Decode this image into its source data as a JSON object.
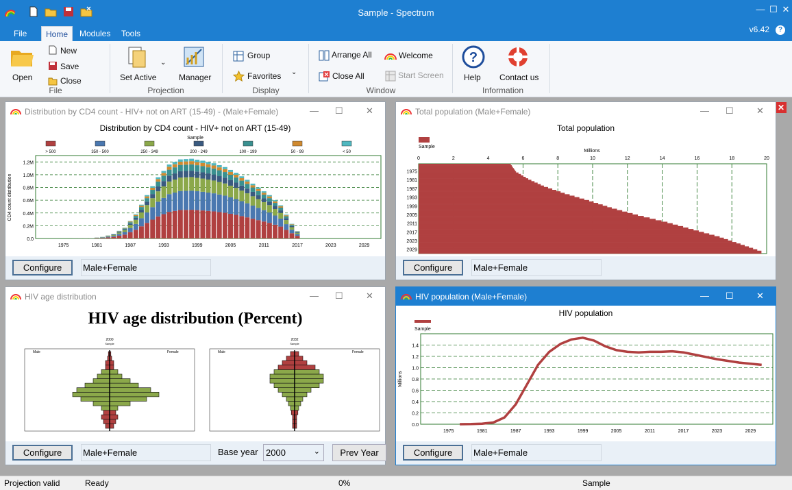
{
  "app": {
    "title": "Sample - Spectrum",
    "version": "v6.42"
  },
  "menu": {
    "file": "File",
    "home": "Home",
    "modules": "Modules",
    "tools": "Tools"
  },
  "ribbon": {
    "open": "Open",
    "new": "New",
    "save": "Save",
    "close": "Close",
    "file_group": "File",
    "set_active": "Set Active",
    "manager": "Manager",
    "projection_group": "Projection",
    "group": "Group",
    "favorites": "Favorites",
    "display_group": "Display",
    "arrange_all": "Arrange All",
    "close_all": "Close All",
    "welcome": "Welcome",
    "start_screen": "Start Screen",
    "window_group": "Window",
    "help": "Help",
    "contact_us": "Contact us",
    "information_group": "Information"
  },
  "windows": {
    "cd4": {
      "title": "Distribution by CD4 count - HIV+ not on ART (15-49) - (Male+Female)",
      "configure": "Configure",
      "field": "Male+Female"
    },
    "totpop": {
      "title": "Total population (Male+Female)",
      "configure": "Configure",
      "field": "Male+Female"
    },
    "agedist": {
      "title": "HIV age distribution",
      "configure": "Configure",
      "field": "Male+Female",
      "base_year_label": "Base year",
      "base_year": "2000",
      "prev_year": "Prev Year"
    },
    "hivpop": {
      "title": "HIV population (Male+Female)",
      "configure": "Configure",
      "field": "Male+Female"
    }
  },
  "status": {
    "left": "Projection valid",
    "ready": "Ready",
    "progress": "0%",
    "projection": "Sample"
  },
  "colors": {
    "accent": "#1e7fd1",
    "red": "#b04040",
    "green": "#8ba84a",
    "blue": "#4a78b0",
    "teal": "#3a9090",
    "orange": "#d08a30",
    "aqua": "#50b8c0",
    "navy": "#3a5a80"
  },
  "chart_data": [
    {
      "type": "bar",
      "id": "cd4",
      "title": "Distribution by CD4 count - HIV+ not on ART (15-49)",
      "legend_title": "Sample",
      "ylabel": "CD4 count distribution",
      "ylim": [
        0,
        1300000
      ],
      "yticks": [
        "0.0",
        "0.2M",
        "0.4M",
        "0.6M",
        "0.8M",
        "1.0M",
        "1.2M"
      ],
      "xticks": [
        "1975",
        "1981",
        "1987",
        "1993",
        "1999",
        "2005",
        "2011",
        "2017",
        "2023",
        "2029"
      ],
      "series": [
        {
          "name": "> 500"
        },
        {
          "name": "350 - 500"
        },
        {
          "name": "250 - 349"
        },
        {
          "name": "200 - 249"
        },
        {
          "name": "100 - 199"
        },
        {
          "name": "50 - 99"
        },
        {
          "name": "< 50"
        }
      ],
      "years": [
        1970,
        1975,
        1980,
        1982,
        1984,
        1986,
        1988,
        1990,
        1992,
        1994,
        1996,
        1998,
        2000,
        2002,
        2004,
        2006,
        2008,
        2010,
        2012,
        2014,
        2016,
        2018,
        2020,
        2030
      ],
      "totals": [
        0,
        0,
        5000,
        25000,
        70000,
        170000,
        380000,
        680000,
        960000,
        1160000,
        1240000,
        1250000,
        1220000,
        1180000,
        1120000,
        1030000,
        920000,
        800000,
        680000,
        520000,
        230000,
        0,
        0,
        0
      ]
    },
    {
      "type": "bar",
      "id": "totpop",
      "title": "Total population",
      "legend": "Sample",
      "xlabel": "Millions",
      "xlim": [
        0,
        20
      ],
      "xticks": [
        "0",
        "2",
        "4",
        "6",
        "8",
        "10",
        "12",
        "14",
        "16",
        "18",
        "20"
      ],
      "yticks": [
        "1975",
        "1981",
        "1987",
        "1993",
        "1999",
        "2005",
        "2011",
        "2017",
        "2023",
        "2029"
      ],
      "years": [
        1970,
        1975,
        1980,
        1985,
        1990,
        1995,
        2000,
        2005,
        2010,
        2015,
        2020,
        2025,
        2030
      ],
      "values": [
        5.3,
        5.6,
        6.3,
        7.2,
        8.4,
        9.8,
        11.1,
        12.6,
        14.3,
        15.8,
        17.3,
        18.5,
        19.7
      ]
    },
    {
      "type": "bar",
      "id": "pyramid",
      "title": "HIV age distribution (Percent)",
      "panels": [
        {
          "year": "2000",
          "subtitle": "Sample",
          "male": "Male",
          "female": "Female"
        },
        {
          "year": "2032",
          "subtitle": "Sample",
          "male": "Male",
          "female": "Female"
        }
      ]
    },
    {
      "type": "line",
      "id": "hivpop",
      "title": "HIV population",
      "legend": "Sample",
      "ylabel": "Millions",
      "ylim": [
        0,
        1.6
      ],
      "yticks": [
        "0.0",
        "0.2",
        "0.4",
        "0.6",
        "0.8",
        "1.0",
        "1.2",
        "1.4"
      ],
      "xticks": [
        "1975",
        "1981",
        "1987",
        "1993",
        "1999",
        "2005",
        "2011",
        "2017",
        "2023",
        "2029"
      ],
      "x": [
        1977,
        1979,
        1981,
        1983,
        1985,
        1987,
        1989,
        1991,
        1993,
        1995,
        1997,
        1999,
        2001,
        2003,
        2005,
        2007,
        2009,
        2011,
        2013,
        2015,
        2017,
        2019,
        2021,
        2023,
        2025,
        2027,
        2029,
        2031
      ],
      "y": [
        0.0,
        0.003,
        0.01,
        0.03,
        0.12,
        0.35,
        0.7,
        1.05,
        1.28,
        1.42,
        1.5,
        1.53,
        1.48,
        1.38,
        1.31,
        1.28,
        1.27,
        1.28,
        1.28,
        1.29,
        1.27,
        1.23,
        1.19,
        1.15,
        1.12,
        1.09,
        1.07,
        1.05
      ]
    }
  ]
}
